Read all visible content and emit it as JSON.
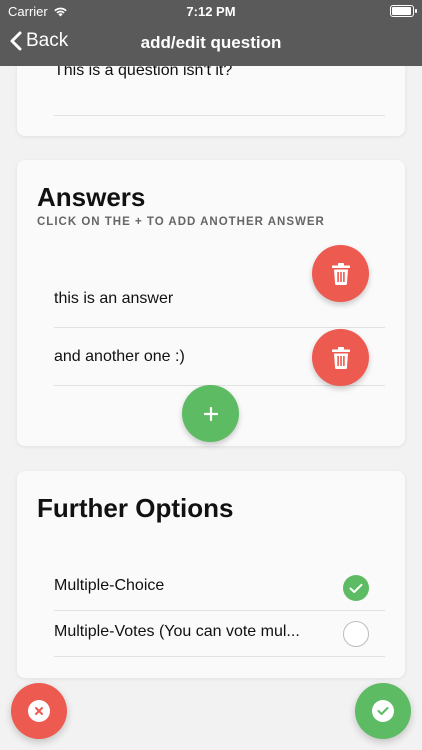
{
  "status_bar": {
    "carrier": "Carrier",
    "time": "7:12 PM"
  },
  "nav": {
    "back_label": "Back",
    "title": "add/edit question"
  },
  "question": {
    "text": "This is a question isn't it?"
  },
  "answers": {
    "title": "Answers",
    "subtitle": "CLICK ON THE + TO ADD ANOTHER ANSWER",
    "items": [
      {
        "text": "this is an answer"
      },
      {
        "text": "and another one :)"
      }
    ]
  },
  "options": {
    "title": "Further Options",
    "items": [
      {
        "label": "Multiple-Choice",
        "checked": true
      },
      {
        "label": "Multiple-Votes (You can vote mul...",
        "checked": false
      }
    ]
  },
  "colors": {
    "header": "#5a5a5a",
    "danger": "#ec5a50",
    "success": "#5dbb63"
  },
  "icons": {
    "back": "chevron-left-icon",
    "delete": "trash-icon",
    "add": "plus-icon",
    "check": "check-icon",
    "cancel": "x-icon"
  }
}
